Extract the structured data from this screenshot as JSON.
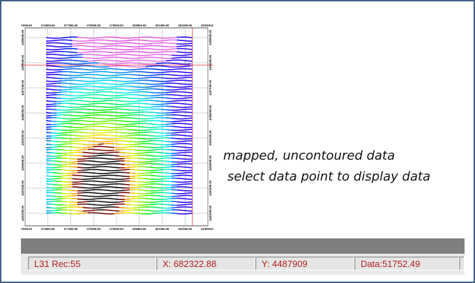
{
  "caption": {
    "line1": "mapped, uncontoured data",
    "line2": "select data point to display data"
  },
  "map": {
    "x_ticks": [
      "675000.00",
      "676000.00",
      "677000.00",
      "678000.00",
      "679000.00",
      "680000.00",
      "681000.00",
      "682000.00",
      "683000.00"
    ],
    "y_ticks": [
      "4489000.00",
      "4488000.00",
      "4487000.00",
      "4486000.00",
      "4485000.00",
      "4484000.00",
      "4483000.00",
      "4482000.00"
    ],
    "selected_point": {
      "x": 682322.88,
      "y": 4487909
    }
  },
  "status": {
    "line_rec": "L31 Rec:55",
    "x": "X: 682322.88",
    "y": "Y: 4487909",
    "data": "Data:51752.49"
  },
  "colors": {
    "frame_border": "#3f5f86",
    "status_text": "#b02020",
    "divider": "#7f7f7f"
  }
}
